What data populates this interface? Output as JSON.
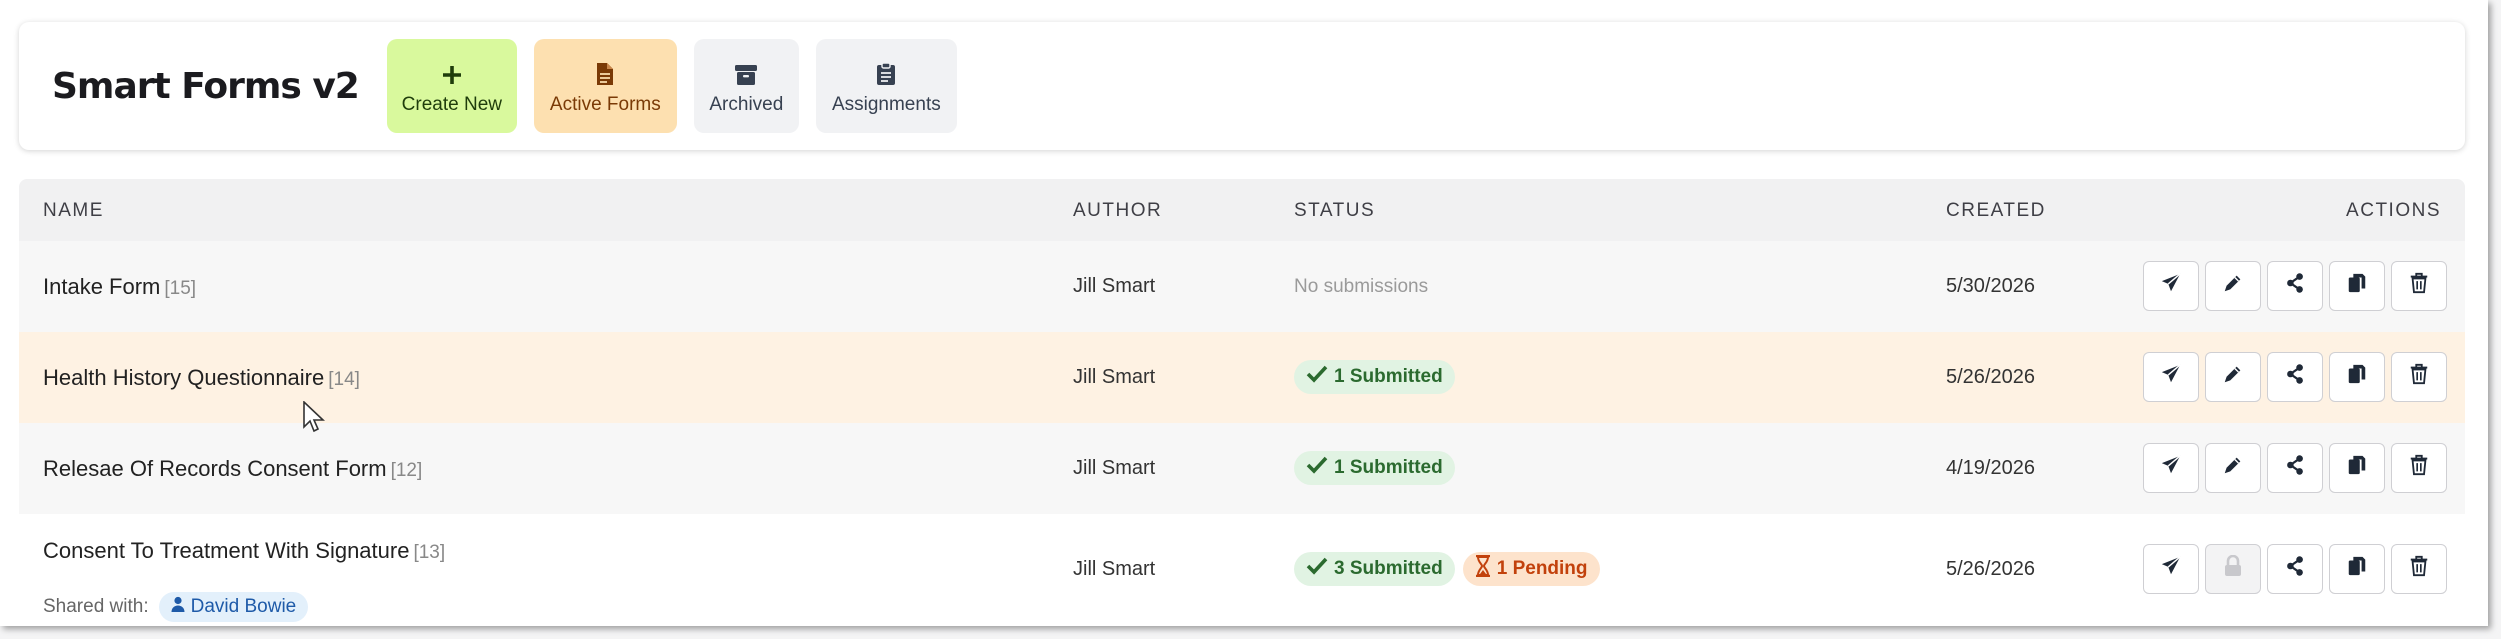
{
  "app": {
    "title": "Smart Forms v2"
  },
  "nav": {
    "create": "Create New",
    "active": "Active Forms",
    "archived": "Archived",
    "assignments": "Assignments"
  },
  "table": {
    "headers": {
      "name": "NAME",
      "author": "AUTHOR",
      "status": "STATUS",
      "created": "CREATED",
      "actions": "ACTIONS"
    },
    "rows": [
      {
        "name": "Intake Form",
        "count": "[15]",
        "author": "Jill Smart",
        "status_text": "No submissions",
        "created": "5/30/2026"
      },
      {
        "name": "Health History Questionnaire",
        "count": "[14]",
        "author": "Jill Smart",
        "submitted": "1 Submitted",
        "created": "5/26/2026"
      },
      {
        "name": "Relesae Of Records Consent Form",
        "count": "[12]",
        "author": "Jill Smart",
        "submitted": "1 Submitted",
        "created": "4/19/2026"
      },
      {
        "name": "Consent To Treatment With Signature",
        "count": "[13]",
        "author": "Jill Smart",
        "submitted": "3 Submitted",
        "pending": "1 Pending",
        "created": "5/26/2026",
        "shared_label": "Shared with:",
        "shared_user": "David Bowie"
      }
    ]
  },
  "icons": {
    "actions": [
      "send-icon",
      "edit-icon",
      "share-icon",
      "copy-icon",
      "delete-icon"
    ],
    "locked_edit": "lock-icon"
  },
  "colors": {
    "create_bg": "#d9f99d",
    "active_bg": "#fde0b0",
    "highlight_row": "#fef2e3",
    "submitted_green": "#2b6a2f",
    "pending_orange": "#c2410c",
    "chip_blue": "#1e5aa8"
  }
}
